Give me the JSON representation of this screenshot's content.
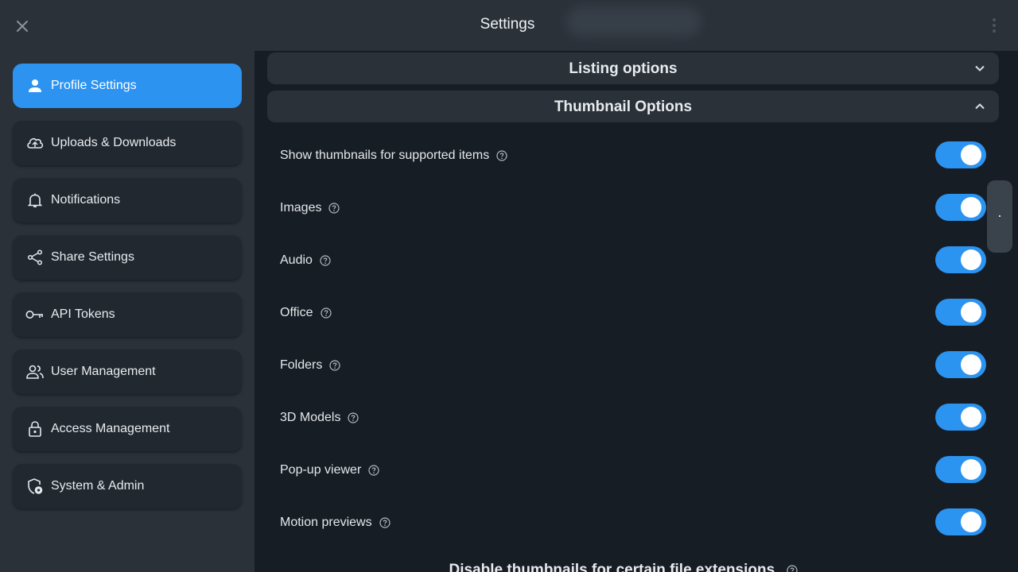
{
  "header": {
    "title": "Settings",
    "close_icon": "close-icon",
    "menu_icon": "more-vertical-icon"
  },
  "sidebar": {
    "items": [
      {
        "label": "Profile Settings",
        "icon": "person-icon",
        "active": true
      },
      {
        "label": "Uploads & Downloads",
        "icon": "cloud-sync-icon",
        "active": false
      },
      {
        "label": "Notifications",
        "icon": "bell-icon",
        "active": false
      },
      {
        "label": "Share Settings",
        "icon": "share-icon",
        "active": false
      },
      {
        "label": "API Tokens",
        "icon": "key-icon",
        "active": false
      },
      {
        "label": "User Management",
        "icon": "users-icon",
        "active": false
      },
      {
        "label": "Access Management",
        "icon": "lock-icon",
        "active": false
      },
      {
        "label": "System & Admin",
        "icon": "shield-gear-icon",
        "active": false
      }
    ]
  },
  "main": {
    "sections": [
      {
        "title": "Listing options",
        "expanded": false
      },
      {
        "title": "Thumbnail Options",
        "expanded": true
      }
    ],
    "thumbnail_options": [
      {
        "label": "Show thumbnails for supported items",
        "enabled": true
      },
      {
        "label": "Images",
        "enabled": true
      },
      {
        "label": "Audio",
        "enabled": true
      },
      {
        "label": "Office",
        "enabled": true
      },
      {
        "label": "Folders",
        "enabled": true
      },
      {
        "label": "3D Models",
        "enabled": true
      },
      {
        "label": "Pop-up viewer",
        "enabled": true
      },
      {
        "label": "Motion previews",
        "enabled": true
      }
    ],
    "subsection_title": "Disable thumbnails for certain file extensions"
  },
  "colors": {
    "accent": "#2c93f1",
    "background": "#171d24",
    "panel": "#2a3139",
    "card": "#212830"
  }
}
